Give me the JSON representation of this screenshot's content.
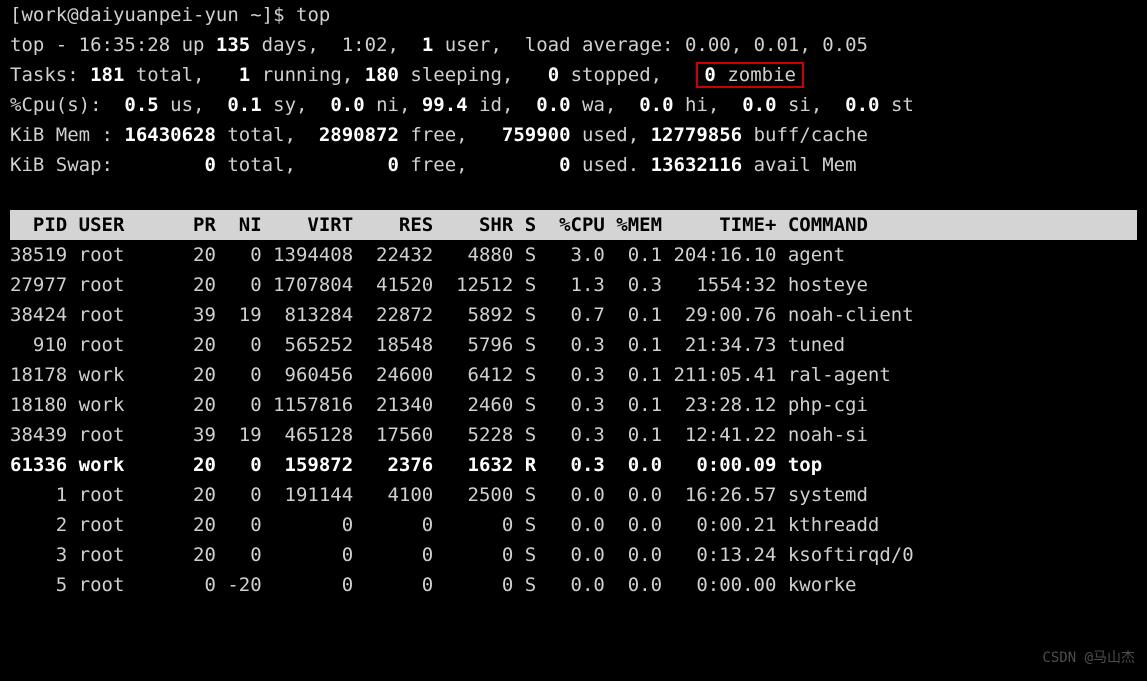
{
  "prompt": "[work@daiyuanpei-yun ~]$",
  "command": "top",
  "summary": {
    "line1": {
      "prefix": "top - 16:35:28 up ",
      "days": "135",
      "mid1": " days,  1:02,  ",
      "users": "1",
      "mid2": " user,  load average: ",
      "load": "0.00, 0.01, 0.05"
    },
    "tasks": {
      "label": "Tasks: ",
      "total": "181",
      "t1": " total,   ",
      "running": "1",
      "t2": " running, ",
      "sleeping": "180",
      "t3": " sleeping,   ",
      "stopped": "0",
      "t4": " stopped,   ",
      "zombie": "0",
      "t5": " zombie"
    },
    "cpu": {
      "label": "%Cpu(s):  ",
      "us": "0.5",
      "t1": " us,  ",
      "sy": "0.1",
      "t2": " sy,  ",
      "ni": "0.0",
      "t3": " ni, ",
      "id": "99.4",
      "t4": " id,  ",
      "wa": "0.0",
      "t5": " wa,  ",
      "hi": "0.0",
      "t6": " hi,  ",
      "si": "0.0",
      "t7": " si,  ",
      "st": "0.0",
      "t8": " st"
    },
    "mem": {
      "label": "KiB Mem : ",
      "total": "16430628",
      "t1": " total,  ",
      "free": "2890872",
      "t2": " free,   ",
      "used": "759900",
      "t3": " used, ",
      "buff": "12779856",
      "t4": " buff/cache"
    },
    "swap": {
      "label": "KiB Swap:        ",
      "total": "0",
      "t1": " total,        ",
      "free": "0",
      "t2": " free,        ",
      "used": "0",
      "t3": " used. ",
      "avail": "13632116",
      "t4": " avail Mem"
    }
  },
  "header_line": "  PID USER      PR  NI    VIRT    RES    SHR S  %CPU %MEM     TIME+ COMMAND",
  "columns": [
    "PID",
    "USER",
    "PR",
    "NI",
    "VIRT",
    "RES",
    "SHR",
    "S",
    "%CPU",
    "%MEM",
    "TIME+",
    "COMMAND"
  ],
  "processes": [
    {
      "pid": "38519",
      "user": "root",
      "pr": "20",
      "ni": "0",
      "virt": "1394408",
      "res": "22432",
      "shr": "4880",
      "s": "S",
      "cpu": "3.0",
      "mem": "0.1",
      "time": "204:16.10",
      "cmd": "agent",
      "bold": false
    },
    {
      "pid": "27977",
      "user": "root",
      "pr": "20",
      "ni": "0",
      "virt": "1707804",
      "res": "41520",
      "shr": "12512",
      "s": "S",
      "cpu": "1.3",
      "mem": "0.3",
      "time": "1554:32",
      "cmd": "hosteye",
      "bold": false
    },
    {
      "pid": "38424",
      "user": "root",
      "pr": "39",
      "ni": "19",
      "virt": "813284",
      "res": "22872",
      "shr": "5892",
      "s": "S",
      "cpu": "0.7",
      "mem": "0.1",
      "time": "29:00.76",
      "cmd": "noah-client",
      "bold": false
    },
    {
      "pid": "910",
      "user": "root",
      "pr": "20",
      "ni": "0",
      "virt": "565252",
      "res": "18548",
      "shr": "5796",
      "s": "S",
      "cpu": "0.3",
      "mem": "0.1",
      "time": "21:34.73",
      "cmd": "tuned",
      "bold": false
    },
    {
      "pid": "18178",
      "user": "work",
      "pr": "20",
      "ni": "0",
      "virt": "960456",
      "res": "24600",
      "shr": "6412",
      "s": "S",
      "cpu": "0.3",
      "mem": "0.1",
      "time": "211:05.41",
      "cmd": "ral-agent",
      "bold": false
    },
    {
      "pid": "18180",
      "user": "work",
      "pr": "20",
      "ni": "0",
      "virt": "1157816",
      "res": "21340",
      "shr": "2460",
      "s": "S",
      "cpu": "0.3",
      "mem": "0.1",
      "time": "23:28.12",
      "cmd": "php-cgi",
      "bold": false
    },
    {
      "pid": "38439",
      "user": "root",
      "pr": "39",
      "ni": "19",
      "virt": "465128",
      "res": "17560",
      "shr": "5228",
      "s": "S",
      "cpu": "0.3",
      "mem": "0.1",
      "time": "12:41.22",
      "cmd": "noah-si",
      "bold": false
    },
    {
      "pid": "61336",
      "user": "work",
      "pr": "20",
      "ni": "0",
      "virt": "159872",
      "res": "2376",
      "shr": "1632",
      "s": "R",
      "cpu": "0.3",
      "mem": "0.0",
      "time": "0:00.09",
      "cmd": "top",
      "bold": true
    },
    {
      "pid": "1",
      "user": "root",
      "pr": "20",
      "ni": "0",
      "virt": "191144",
      "res": "4100",
      "shr": "2500",
      "s": "S",
      "cpu": "0.0",
      "mem": "0.0",
      "time": "16:26.57",
      "cmd": "systemd",
      "bold": false
    },
    {
      "pid": "2",
      "user": "root",
      "pr": "20",
      "ni": "0",
      "virt": "0",
      "res": "0",
      "shr": "0",
      "s": "S",
      "cpu": "0.0",
      "mem": "0.0",
      "time": "0:00.21",
      "cmd": "kthreadd",
      "bold": false
    },
    {
      "pid": "3",
      "user": "root",
      "pr": "20",
      "ni": "0",
      "virt": "0",
      "res": "0",
      "shr": "0",
      "s": "S",
      "cpu": "0.0",
      "mem": "0.0",
      "time": "0:13.24",
      "cmd": "ksoftirqd/0",
      "bold": false
    },
    {
      "pid": "5",
      "user": "root",
      "pr": "0",
      "ni": "-20",
      "virt": "0",
      "res": "0",
      "shr": "0",
      "s": "S",
      "cpu": "0.0",
      "mem": "0.0",
      "time": "0:00.00",
      "cmd": "kworke",
      "bold": false
    }
  ],
  "watermark": "CSDN @马山杰"
}
